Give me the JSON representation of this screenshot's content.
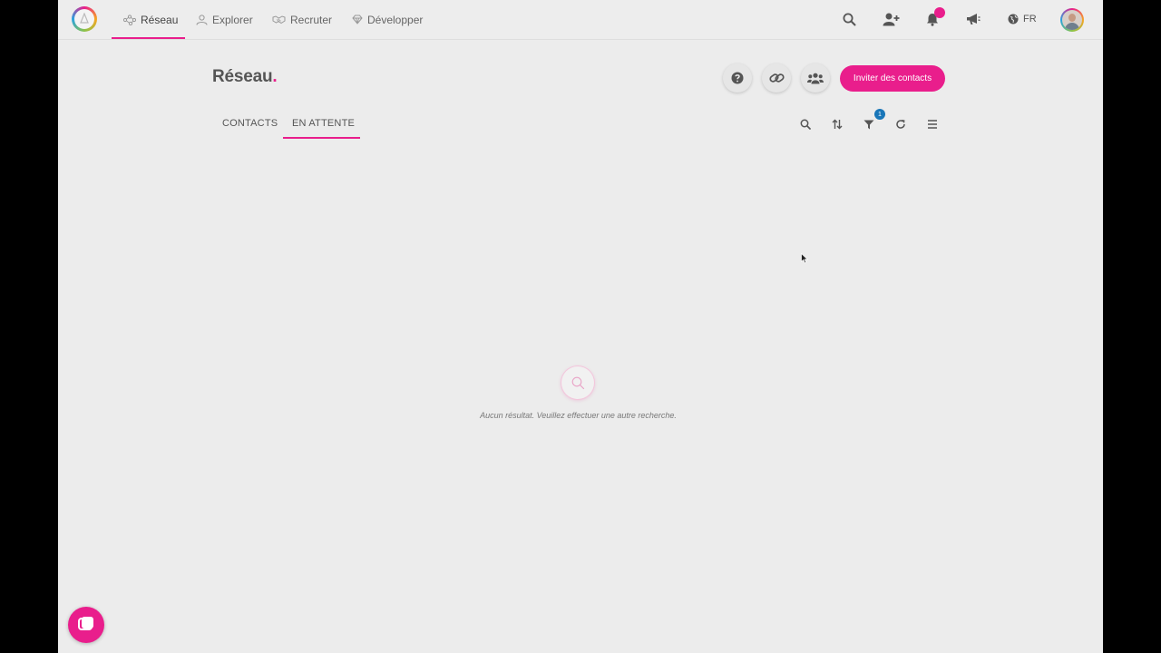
{
  "nav": {
    "items": [
      {
        "label": "Réseau",
        "icon": "network-icon",
        "active": true
      },
      {
        "label": "Explorer",
        "icon": "user-outline-icon",
        "active": false
      },
      {
        "label": "Recruter",
        "icon": "handshake-icon",
        "active": false
      },
      {
        "label": "Développer",
        "icon": "diamond-icon",
        "active": false
      }
    ],
    "language": "FR",
    "accent_color": "#e91e8c"
  },
  "page": {
    "title": "Réseau",
    "title_dot": ".",
    "invite_label": "Inviter des contacts"
  },
  "tabs": [
    {
      "label": "CONTACTS",
      "active": false
    },
    {
      "label": "EN ATTENTE",
      "active": true
    }
  ],
  "toolbar": {
    "filter_count": "1"
  },
  "empty_state": {
    "message": "Aucun résultat. Veuillez effectuer une autre recherche."
  }
}
